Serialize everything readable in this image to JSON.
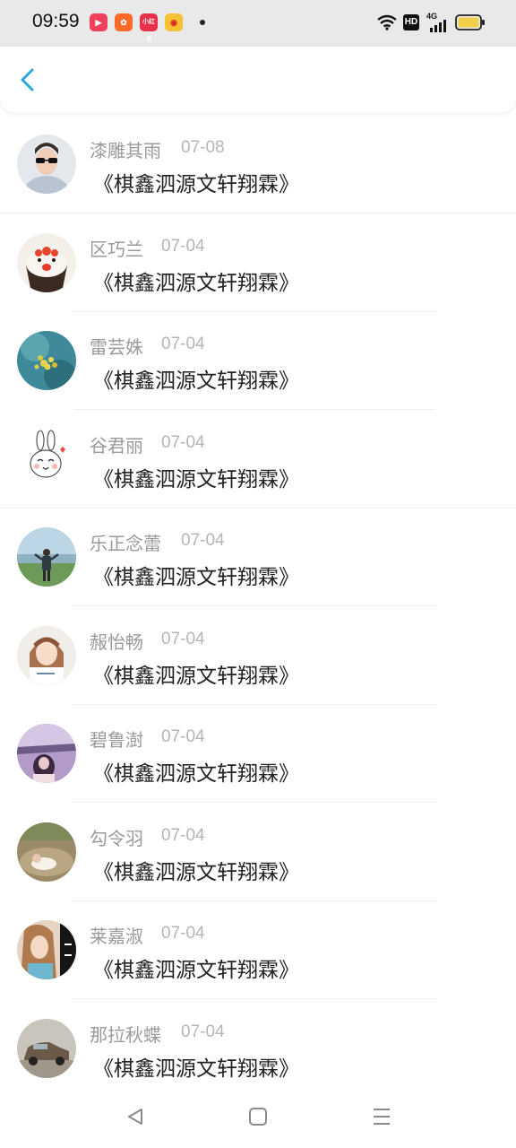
{
  "status_bar": {
    "time": "09:59",
    "app_icons": [
      {
        "name": "video-app-icon",
        "color": "#f0405a",
        "glyph": "▶"
      },
      {
        "name": "kuaishou-app-icon",
        "color": "#ff6a2a",
        "glyph": "✿"
      },
      {
        "name": "xiaohongshu-app-icon",
        "color": "#e8304a",
        "glyph": "小红书"
      },
      {
        "name": "weibo-app-icon",
        "color": "#f5c235",
        "glyph": "◉"
      }
    ],
    "hd_badge": "HD",
    "network_label": "4G"
  },
  "header": {
    "back_icon": "chevron-left-icon",
    "accent_color": "#2aa7e0"
  },
  "comments": [
    {
      "name": "漆雕其雨",
      "date": "07-08",
      "message": "《棋鑫泗源文轩翔霖》",
      "avatar": "man-sunglasses"
    },
    {
      "name": "区巧兰",
      "date": "07-04",
      "message": "《棋鑫泗源文轩翔霖》",
      "avatar": "cupcake"
    },
    {
      "name": "雷芸姝",
      "date": "07-04",
      "message": "《棋鑫泗源文轩翔霖》",
      "avatar": "flowers"
    },
    {
      "name": "谷君丽",
      "date": "07-04",
      "message": "《棋鑫泗源文轩翔霖》",
      "avatar": "cartoon-rabbit"
    },
    {
      "name": "乐正念蕾",
      "date": "07-04",
      "message": "《棋鑫泗源文轩翔霖》",
      "avatar": "field-person"
    },
    {
      "name": "赧怡畅",
      "date": "07-04",
      "message": "《棋鑫泗源文轩翔霖》",
      "avatar": "girl-shirt"
    },
    {
      "name": "碧鲁澍",
      "date": "07-04",
      "message": "《棋鑫泗源文轩翔霖》",
      "avatar": "girl-purple"
    },
    {
      "name": "勾令羽",
      "date": "07-04",
      "message": "《棋鑫泗源文轩翔霖》",
      "avatar": "baby-dirt"
    },
    {
      "name": "莱嘉淑",
      "date": "07-04",
      "message": "《棋鑫泗源文轩翔霖》",
      "avatar": "girl-sign"
    },
    {
      "name": "那拉秋蝶",
      "date": "07-04",
      "message": "《棋鑫泗源文轩翔霖》",
      "avatar": "vintage-car"
    }
  ],
  "nav_bar": {
    "back": "triangle-back-icon",
    "home": "square-home-icon",
    "menu": "three-lines-menu-icon"
  }
}
